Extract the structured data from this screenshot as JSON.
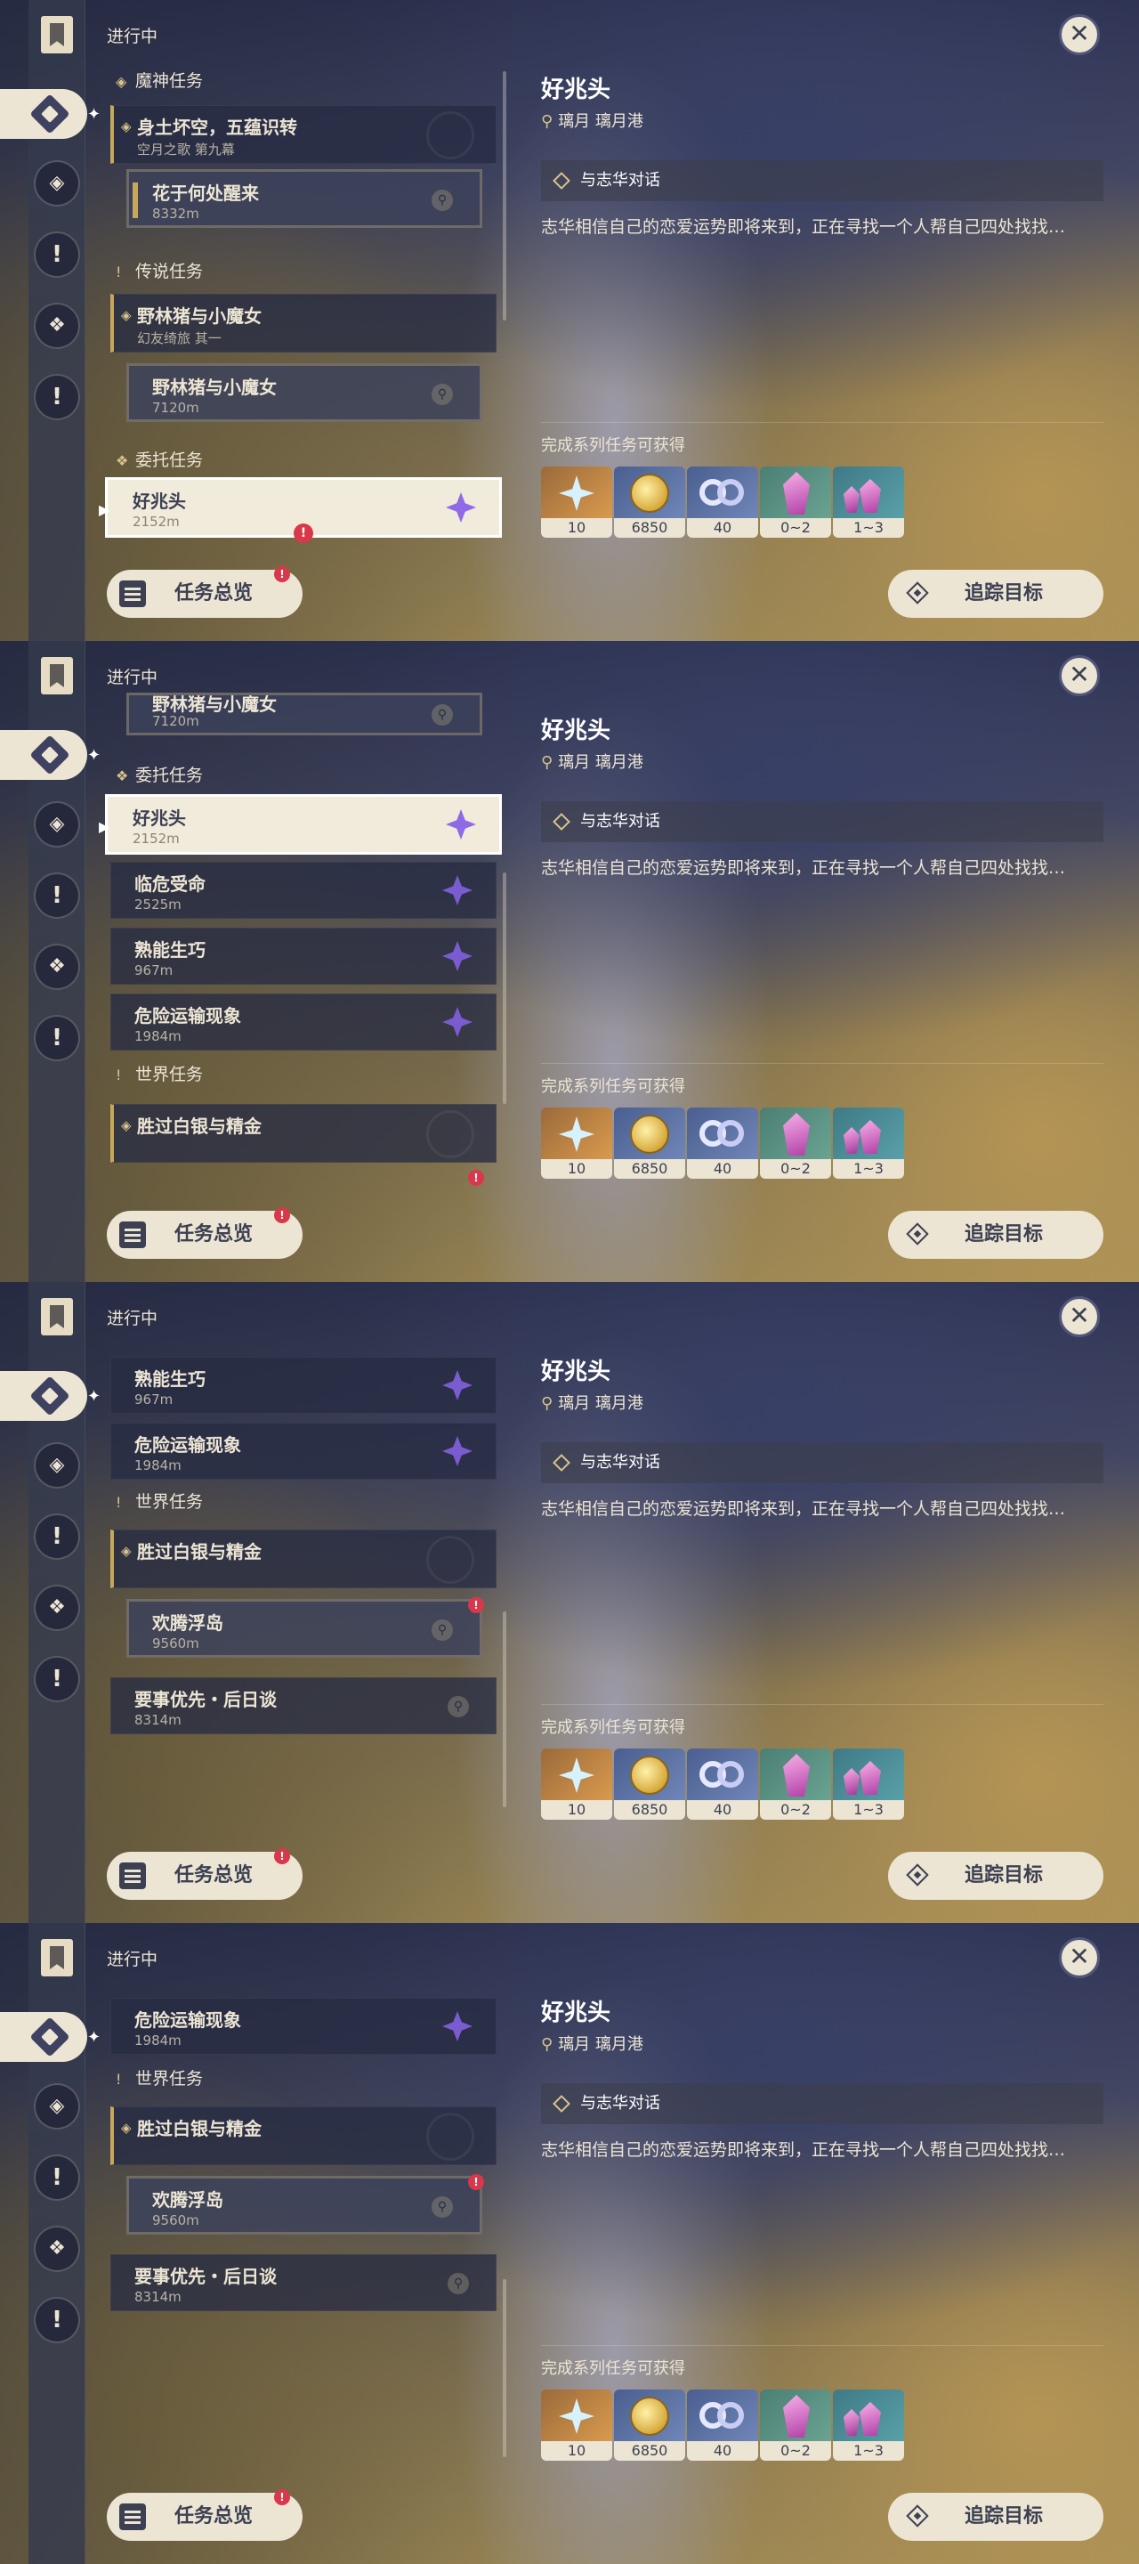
{
  "header": {
    "in_progress": "进行中"
  },
  "categories": {
    "archon": "魔神任务",
    "story": "传说任务",
    "commission": "委托任务",
    "world": "世界任务"
  },
  "quests": {
    "archon_main": {
      "title": "身土坏空，五蕴识转",
      "sub": "空月之歌 第九幕"
    },
    "archon_step": {
      "title": "花于何处醒来",
      "dist": "8332m"
    },
    "story_main": {
      "title": "野林猪与小魔女",
      "sub": "幻友绮旅 其一"
    },
    "story_step": {
      "title": "野林猪与小魔女",
      "dist": "7120m"
    },
    "haozhaotou": {
      "title": "好兆头",
      "dist": "2152m"
    },
    "linwei": {
      "title": "临危受命",
      "dist": "2525m"
    },
    "shuneng": {
      "title": "熟能生巧",
      "dist": "967m"
    },
    "weixian": {
      "title": "危险运输现象",
      "dist": "1984m"
    },
    "world_main": {
      "title": "胜过白银与精金"
    },
    "huanteng": {
      "title": "欢腾浮岛",
      "dist": "9560m"
    },
    "yaoshi": {
      "title": "要事优先・后日谈",
      "dist": "8314m"
    }
  },
  "detail": {
    "title": "好兆头",
    "location": "璃月 璃月港",
    "objective": "与志华对话",
    "description": "志华相信自己的恋爱运势即将来到，正在寻找一个人帮自己四处找找…",
    "rewards_label": "完成系列任务可获得",
    "rewards": [
      {
        "icon": "adventure-exp-icon",
        "qty": "10"
      },
      {
        "icon": "mora-icon",
        "qty": "6850"
      },
      {
        "icon": "companionship-exp-icon",
        "qty": "40"
      },
      {
        "icon": "ore-crystal-icon",
        "qty": "0~2"
      },
      {
        "icon": "ore-crystal-cluster-icon",
        "qty": "1~3"
      }
    ]
  },
  "buttons": {
    "overview": "任务总览",
    "track": "追踪目标"
  },
  "glyphs": {
    "close": "✕",
    "pin": "⚲",
    "alert": "!",
    "star": "✦",
    "arrow": "▶"
  }
}
